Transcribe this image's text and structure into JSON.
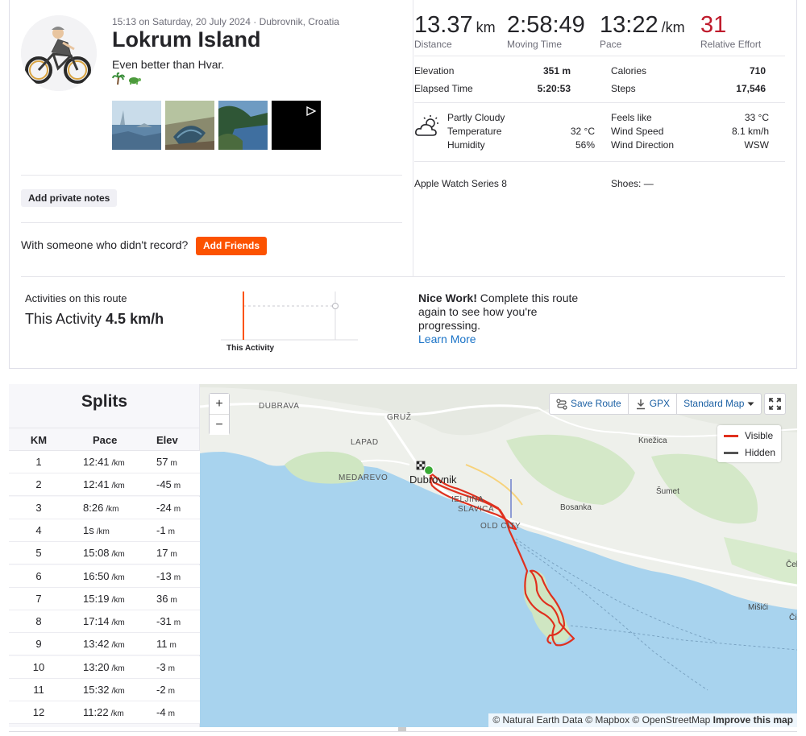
{
  "activity": {
    "meta": "15:13 on Saturday, 20 July 2024 · Dubrovnik, Croatia",
    "title": "Lokrum Island",
    "description": "Even better than Hvar.",
    "emoji_icons": [
      "palm-tree-icon",
      "turtle-icon"
    ],
    "photos": [
      "photo-1",
      "photo-2",
      "photo-3",
      "video-4"
    ],
    "add_notes_label": "Add private notes",
    "with_someone_text": "With someone who didn't record?",
    "add_friends_label": "Add Friends"
  },
  "stats": {
    "distance": {
      "value": "13.37",
      "unit": "km",
      "label": "Distance"
    },
    "moving_time": {
      "value": "2:58:49",
      "label": "Moving Time"
    },
    "pace": {
      "value": "13:22",
      "unit": "/km",
      "label": "Pace"
    },
    "relative_effort": {
      "value": "31",
      "label": "Relative Effort"
    },
    "elevation": {
      "label": "Elevation",
      "value": "351 m"
    },
    "elapsed_time": {
      "label": "Elapsed Time",
      "value": "5:20:53"
    },
    "calories": {
      "label": "Calories",
      "value": "710"
    },
    "steps": {
      "label": "Steps",
      "value": "17,546"
    }
  },
  "weather": {
    "condition": "Partly Cloudy",
    "temperature_label": "Temperature",
    "temperature": "32 °C",
    "humidity_label": "Humidity",
    "humidity": "56%",
    "feels_like_label": "Feels like",
    "feels_like": "33 °C",
    "wind_speed_label": "Wind Speed",
    "wind_speed": "8.1 km/h",
    "wind_direction_label": "Wind Direction",
    "wind_direction": "WSW"
  },
  "gear": {
    "device": "Apple Watch Series 8",
    "shoes": "Shoes: —"
  },
  "route": {
    "label": "Activities on this route",
    "this_activity_prefix": "This Activity",
    "this_activity_speed": "4.5 km/h",
    "chart_label": "This Activity",
    "nice_work_bold": "Nice Work!",
    "nice_work_text": " Complete this route again to see how you're progressing.",
    "learn_more": "Learn More"
  },
  "splits": {
    "title": "Splits",
    "headers": {
      "km": "KM",
      "pace": "Pace",
      "elev": "Elev"
    },
    "pace_unit": "/km",
    "elev_unit": "m",
    "rows": [
      {
        "km": "1",
        "pace": "12:41",
        "elev": "57"
      },
      {
        "km": "2",
        "pace": "12:41",
        "elev": "-45"
      },
      {
        "km": "3",
        "pace": "8:26",
        "elev": "-24"
      },
      {
        "km": "4",
        "pace": "1s",
        "elev": "-1"
      },
      {
        "km": "5",
        "pace": "15:08",
        "elev": "17"
      },
      {
        "km": "6",
        "pace": "16:50",
        "elev": "-13"
      },
      {
        "km": "7",
        "pace": "15:19",
        "elev": "36"
      },
      {
        "km": "8",
        "pace": "17:14",
        "elev": "-31"
      },
      {
        "km": "9",
        "pace": "13:42",
        "elev": "11"
      },
      {
        "km": "10",
        "pace": "13:20",
        "elev": "-3"
      },
      {
        "km": "11",
        "pace": "15:32",
        "elev": "-2"
      },
      {
        "km": "12",
        "pace": "11:22",
        "elev": "-4"
      }
    ]
  },
  "map": {
    "zoom_in": "+",
    "zoom_out": "−",
    "save_route": "Save Route",
    "gpx": "GPX",
    "map_style": "Standard Map",
    "legend_visible": "Visible",
    "legend_hidden": "Hidden",
    "attribution_text": "© Natural Earth Data © Mapbox © OpenStreetMap ",
    "attribution_link": "Improve this map",
    "places": {
      "dubrava": "DUBRAVA",
      "gruz": "GRUŽ",
      "lapad": "LAPAD",
      "medarevo": "MEDAREVO",
      "dubrovnik": "Dubrovnik",
      "ploce": "IELJINA",
      "ploce2": "SLAVICA",
      "old_city": "OLD CITY",
      "bosanka": "Bosanka",
      "knezica": "Knežica",
      "sumet": "Šumet",
      "cele": "Čel",
      "misici": "Mišići",
      "cil": "Čil"
    },
    "colors": {
      "route": "#e0301e",
      "hidden": "#555555",
      "water": "#a8d3ee",
      "land": "#eef0eb",
      "park": "#cfe6c2"
    }
  },
  "colors": {
    "accent": "#fc5200",
    "relative_effort": "#bf1b2c",
    "link": "#1a73c7"
  }
}
